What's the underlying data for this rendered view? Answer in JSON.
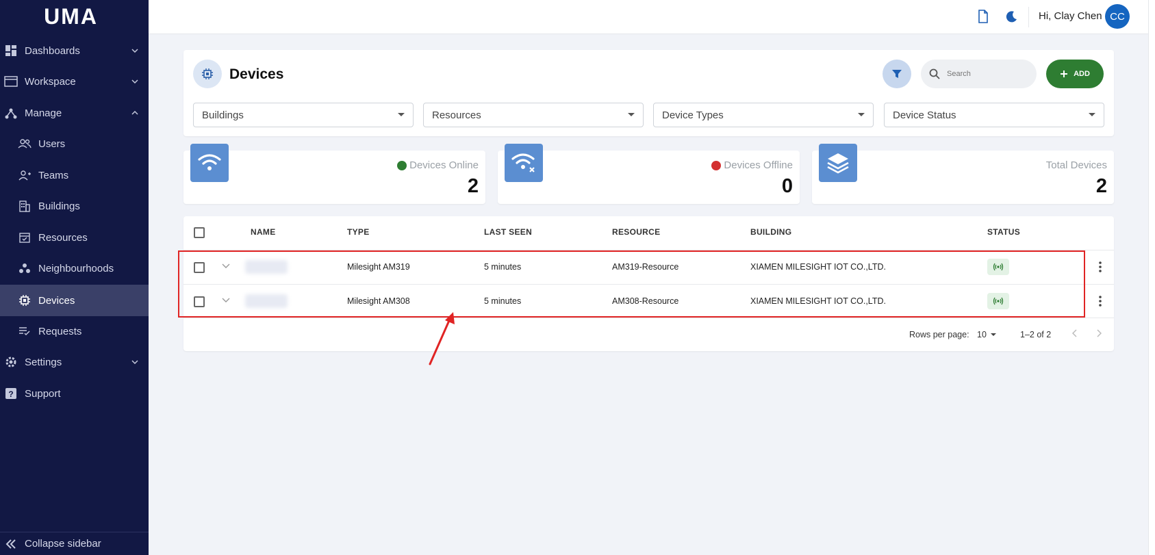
{
  "app": {
    "logo": "UMA"
  },
  "sidebar": {
    "items": [
      {
        "label": "Dashboards",
        "icon": "dashboard-icon"
      },
      {
        "label": "Workspace",
        "icon": "workspace-icon"
      },
      {
        "label": "Manage",
        "icon": "manage-icon"
      },
      {
        "label": "Users",
        "icon": "users-icon"
      },
      {
        "label": "Teams",
        "icon": "teams-icon"
      },
      {
        "label": "Buildings",
        "icon": "building-icon"
      },
      {
        "label": "Resources",
        "icon": "calendar-check-icon"
      },
      {
        "label": "Neighbourhoods",
        "icon": "neighbourhood-icon"
      },
      {
        "label": "Devices",
        "icon": "chip-icon"
      },
      {
        "label": "Requests",
        "icon": "list-check-icon"
      },
      {
        "label": "Settings",
        "icon": "gear-icon"
      },
      {
        "label": "Support",
        "icon": "help-icon"
      }
    ],
    "collapse_label": "Collapse sidebar"
  },
  "topbar": {
    "greeting": "Hi, Clay Chen",
    "avatar_initials": "CC"
  },
  "header": {
    "title": "Devices",
    "search_placeholder": "Search",
    "add_label": "ADD",
    "filters": [
      "Buildings",
      "Resources",
      "Device Types",
      "Device Status"
    ]
  },
  "stats": [
    {
      "label": "Devices Online",
      "value": "2",
      "dot_color": "#2e7d32"
    },
    {
      "label": "Devices Offline",
      "value": "0",
      "dot_color": "#d32f2f"
    },
    {
      "label": "Total Devices",
      "value": "2"
    }
  ],
  "table": {
    "columns": [
      "NAME",
      "TYPE",
      "LAST SEEN",
      "RESOURCE",
      "BUILDING",
      "STATUS"
    ],
    "rows": [
      {
        "type": "Milesight AM319",
        "last_seen": "5 minutes",
        "resource": "AM319-Resource",
        "building": "XIAMEN MILESIGHT IOT CO.,LTD.",
        "status": "online"
      },
      {
        "type": "Milesight AM308",
        "last_seen": "5 minutes",
        "resource": "AM308-Resource",
        "building": "XIAMEN MILESIGHT IOT CO.,LTD.",
        "status": "online"
      }
    ],
    "rows_per_page_label": "Rows per page:",
    "rows_per_page": "10",
    "range": "1–2 of 2"
  },
  "colors": {
    "sidebar_bg": "#121844",
    "accent": "#5b8ed1",
    "add_green": "#2e7d32",
    "annotation": "#e02424"
  }
}
